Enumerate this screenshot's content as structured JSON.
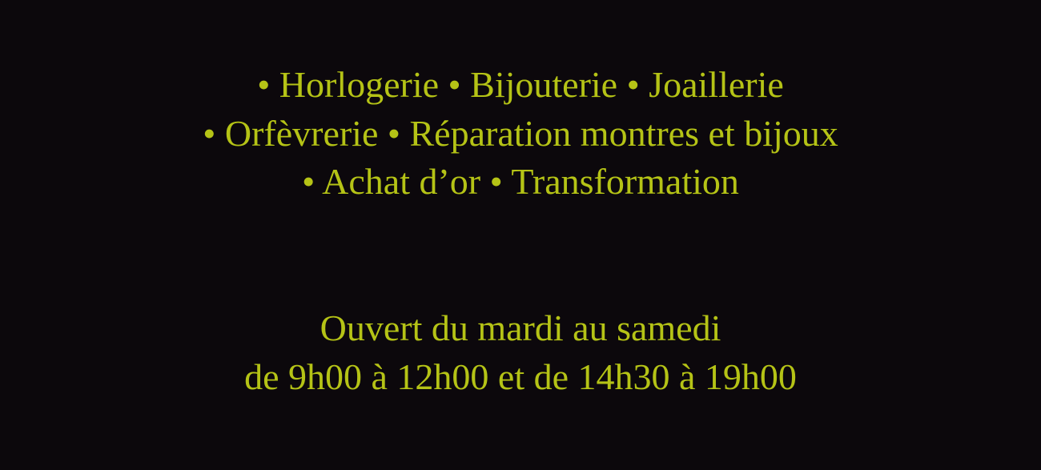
{
  "services": {
    "lines": [
      "• Horlogerie • Bijouterie • Joaillerie",
      "• Orfèvrerie • Réparation montres et bijoux",
      "• Achat d’or • Transformation"
    ]
  },
  "hours": {
    "days": "Ouvert du mardi au samedi",
    "times": "de 9h00 à 12h00 et de 14h30 à 19h00"
  },
  "colors": {
    "background": "#0c080c",
    "text": "#b5c316"
  }
}
